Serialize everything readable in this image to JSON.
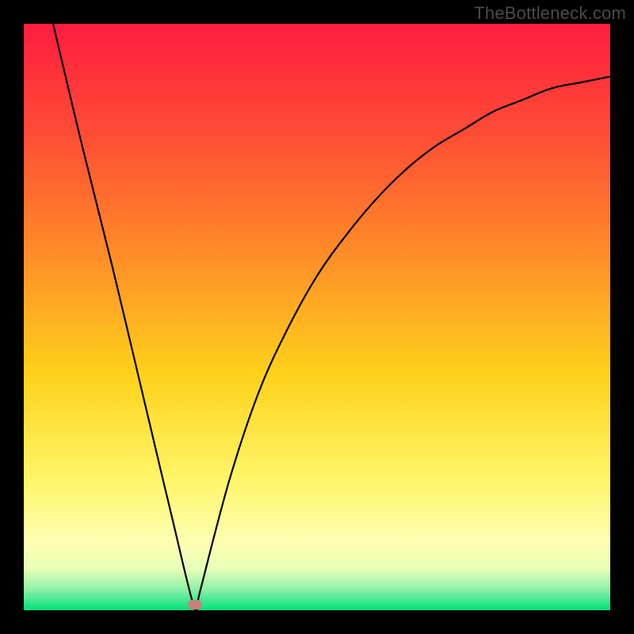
{
  "watermark": "TheBottleneck.com",
  "chart_data": {
    "type": "line",
    "title": "",
    "xlabel": "",
    "ylabel": "",
    "xlim": [
      0,
      1
    ],
    "ylim": [
      0,
      1
    ],
    "grid": false,
    "series": [
      {
        "name": "bottleneck-curve",
        "color": "#000000",
        "x": [
          0.05,
          0.1,
          0.15,
          0.2,
          0.25,
          0.292,
          0.3,
          0.35,
          0.4,
          0.45,
          0.5,
          0.55,
          0.6,
          0.65,
          0.7,
          0.75,
          0.8,
          0.85,
          0.9,
          0.95,
          1.0
        ],
        "y": [
          1.0,
          0.79,
          0.59,
          0.38,
          0.17,
          0.0,
          0.03,
          0.22,
          0.37,
          0.48,
          0.57,
          0.64,
          0.7,
          0.75,
          0.79,
          0.82,
          0.85,
          0.87,
          0.89,
          0.9,
          0.91
        ]
      }
    ],
    "marker": {
      "name": "min-point",
      "x": 0.292,
      "y": 0.01,
      "color": "#c7827b"
    },
    "gradient_stops": [
      {
        "offset": 0.0,
        "color": "#ff1c3f"
      },
      {
        "offset": 0.2,
        "color": "#ff5034"
      },
      {
        "offset": 0.4,
        "color": "#ff8f27"
      },
      {
        "offset": 0.6,
        "color": "#ffd21a"
      },
      {
        "offset": 0.78,
        "color": "#fff66a"
      },
      {
        "offset": 0.88,
        "color": "#ffffb0"
      },
      {
        "offset": 0.93,
        "color": "#e8ffb8"
      },
      {
        "offset": 0.965,
        "color": "#8cf0a8"
      },
      {
        "offset": 1.0,
        "color": "#00e07a"
      }
    ]
  }
}
